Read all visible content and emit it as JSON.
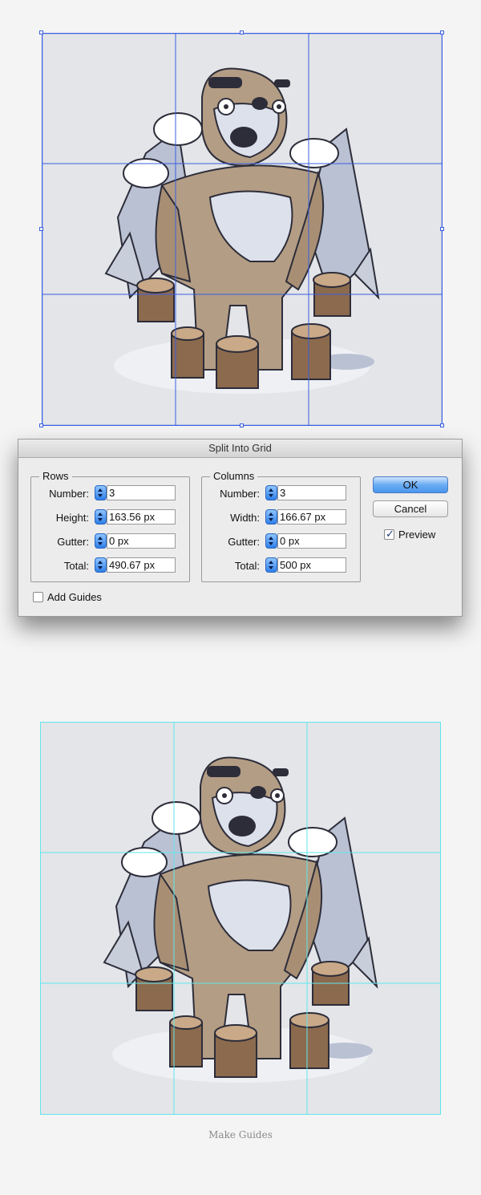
{
  "dialog": {
    "title": "Split Into Grid",
    "rows": {
      "legend": "Rows",
      "number_label": "Number:",
      "number_value": "3",
      "height_label": "Height:",
      "height_value": "163.56 px",
      "gutter_label": "Gutter:",
      "gutter_value": "0 px",
      "total_label": "Total:",
      "total_value": "490.67 px"
    },
    "columns": {
      "legend": "Columns",
      "number_label": "Number:",
      "number_value": "3",
      "width_label": "Width:",
      "width_value": "166.67 px",
      "gutter_label": "Gutter:",
      "gutter_value": "0 px",
      "total_label": "Total:",
      "total_value": "500 px"
    },
    "buttons": {
      "ok": "OK",
      "cancel": "Cancel"
    },
    "preview": {
      "label": "Preview",
      "checked": true
    },
    "add_guides": {
      "label": "Add Guides",
      "checked": false
    }
  },
  "caption": "Make Guides",
  "colors": {
    "selection_blue": "#3a5fe0",
    "guide_cyan": "#5fe6ee",
    "artboard_bg": "#e3e5e8",
    "ok_button": "#4a95ee"
  }
}
